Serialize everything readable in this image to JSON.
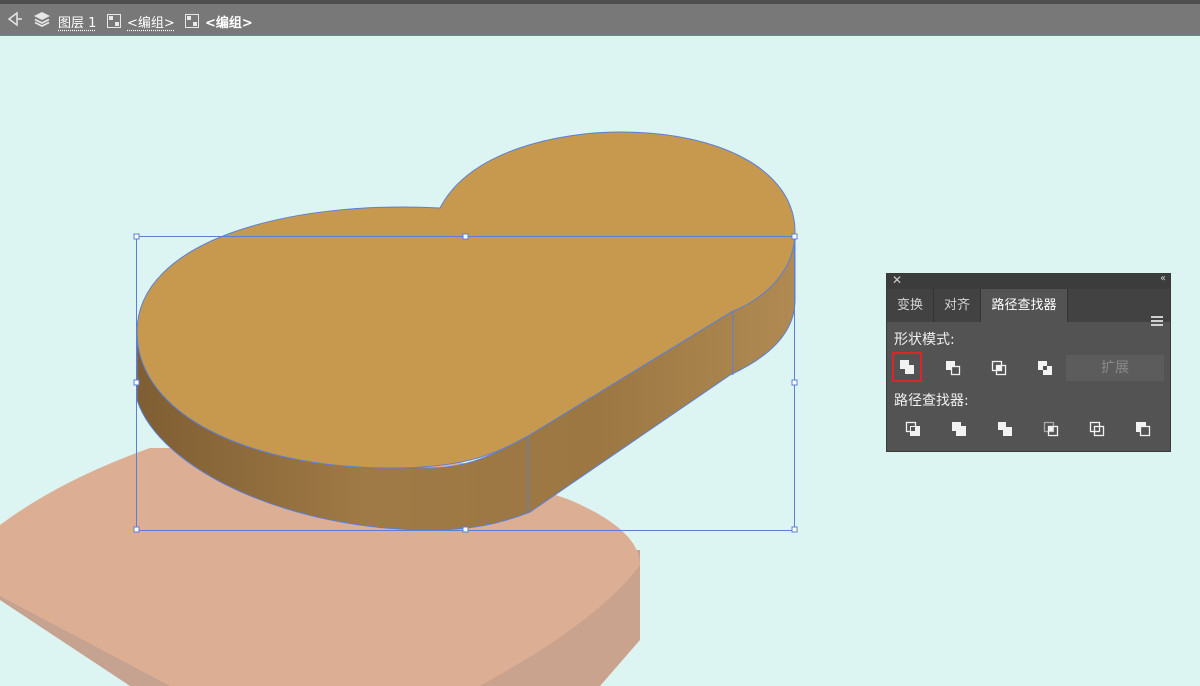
{
  "breadcrumb": {
    "back_icon": "back-arrow-icon",
    "layers_icon": "layers-icon",
    "items": [
      {
        "label": "图层 1",
        "icon": "layers-icon"
      },
      {
        "label": "<编组>",
        "icon": "group-icon"
      },
      {
        "label": "<编组>",
        "icon": "group-icon"
      }
    ]
  },
  "canvas": {
    "background": "#ddf5f2",
    "shape_top_color": "#c7994e",
    "shape_side_color": "#9b7440",
    "base_color": "#dcae94",
    "selection_color": "#5b7fd6"
  },
  "pathfinder_panel": {
    "tabs": [
      {
        "label": "变换",
        "active": false
      },
      {
        "label": "对齐",
        "active": false
      },
      {
        "label": "路径查找器",
        "active": true
      }
    ],
    "shape_modes_label": "形状模式:",
    "shape_modes": [
      "unite-icon",
      "minus-front-icon",
      "intersect-icon",
      "exclude-icon"
    ],
    "expand_label": "扩展",
    "pathfinders_label": "路径查找器:",
    "pathfinders": [
      "divide-icon",
      "trim-icon",
      "merge-icon",
      "crop-icon",
      "outline-icon",
      "minus-back-icon"
    ]
  }
}
